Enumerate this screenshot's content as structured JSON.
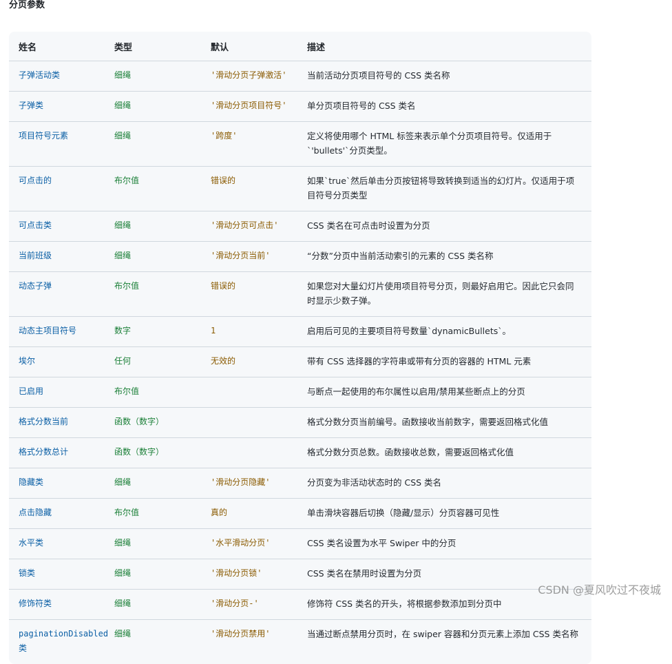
{
  "title": "分页参数",
  "columns": [
    "姓名",
    "类型",
    "默认",
    "描述"
  ],
  "rows": [
    {
      "name": "子弹活动类",
      "type": "细绳",
      "default": "'滑动分页子弹激活'",
      "desc": "当前活动分页项目符号的 CSS 类名称"
    },
    {
      "name": "子弹类",
      "type": "细绳",
      "default": "'滑动分页项目符号'",
      "desc": "单分页项目符号的 CSS 类名"
    },
    {
      "name": "项目符号元素",
      "type": "细绳",
      "default": "'跨度'",
      "desc": "定义将使用哪个 HTML 标签来表示单个分页项目符号。仅适用于`'bullets'`分页类型。"
    },
    {
      "name": "可点击的",
      "type": "布尔值",
      "default": "错误的",
      "desc": "如果`true`然后单击分页按钮将导致转换到适当的幻灯片。仅适用于项目符号分页类型"
    },
    {
      "name": "可点击类",
      "type": "细绳",
      "default": "'滑动分页可点击'",
      "desc": "CSS 类名在可点击时设置为分页"
    },
    {
      "name": "当前班级",
      "type": "细绳",
      "default": "'滑动分页当前'",
      "desc": "“分数”分页中当前活动索引的元素的 CSS 类名称"
    },
    {
      "name": "动态子弹",
      "type": "布尔值",
      "default": "错误的",
      "desc": "如果您对大量幻灯片使用项目符号分页，则最好启用它。因此它只会同时显示少数子弹。"
    },
    {
      "name": "动态主项目符号",
      "type": "数字",
      "default": "1",
      "desc": "启用后可见的主要项目符号数量`dynamicBullets`。"
    },
    {
      "name": "埃尔",
      "type": "任何",
      "default": "无效的",
      "desc": "带有 CSS 选择器的字符串或带有分页的容器的 HTML 元素"
    },
    {
      "name": "已启用",
      "type": "布尔值",
      "default": "",
      "desc": "与断点一起使用的布尔属性以启用/禁用某些断点上的分页"
    },
    {
      "name": "格式分数当前",
      "type": "函数（数字）",
      "default": "",
      "desc": "格式分数分页当前编号。函数接收当前数字，需要返回格式化值"
    },
    {
      "name": "格式分数总计",
      "type": "函数（数字）",
      "default": "",
      "desc": "格式分数分页总数。函数接收总数，需要返回格式化值"
    },
    {
      "name": "隐藏类",
      "type": "细绳",
      "default": "'滑动分页隐藏'",
      "desc": "分页变为非活动状态时的 CSS 类名"
    },
    {
      "name": "点击隐藏",
      "type": "布尔值",
      "default": "真的",
      "desc": "单击滑块容器后切换（隐藏/显示）分页容器可见性"
    },
    {
      "name": "水平类",
      "type": "细绳",
      "default": "'水平滑动分页'",
      "desc": "CSS 类名设置为水平 Swiper 中的分页"
    },
    {
      "name": "锁类",
      "type": "细绳",
      "default": "'滑动分页锁'",
      "desc": "CSS 类名在禁用时设置为分页"
    },
    {
      "name": "修饰符类",
      "type": "细绳",
      "default": "'滑动分页-'",
      "desc": "修饰符 CSS 类名的开头，将根据参数添加到分页中"
    },
    {
      "name": "paginationDisabled类",
      "type": "细绳",
      "default": "'滑动分页禁用'",
      "desc": "当通过断点禁用分页时，在 swiper 容器和分页元素上添加 CSS 类名称"
    }
  ],
  "watermark": "CSDN @夏风吹过不夜城"
}
